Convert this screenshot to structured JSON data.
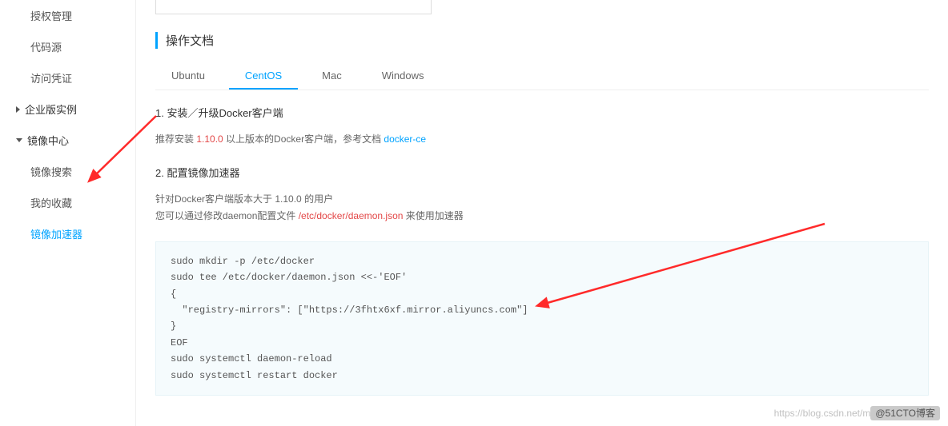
{
  "sidebar": {
    "items": [
      {
        "label": "授权管理"
      },
      {
        "label": "代码源"
      },
      {
        "label": "访问凭证"
      },
      {
        "label": "企业版实例"
      },
      {
        "label": "镜像中心"
      },
      {
        "label": "镜像搜索"
      },
      {
        "label": "我的收藏"
      },
      {
        "label": "镜像加速器"
      }
    ]
  },
  "section_title": "操作文档",
  "tabs": {
    "ubuntu": "Ubuntu",
    "centos": "CentOS",
    "mac": "Mac",
    "windows": "Windows"
  },
  "step1": {
    "heading": "1. 安装／升级Docker客户端",
    "desc_prefix": "推荐安装 ",
    "version": "1.10.0",
    "desc_mid": " 以上版本的Docker客户端，参考文档 ",
    "link": "docker-ce"
  },
  "step2": {
    "heading": "2. 配置镜像加速器",
    "line1_prefix": "针对Docker客户端版本大于 ",
    "line1_version": "1.10.0",
    "line1_suffix": " 的用户",
    "line2_prefix": "您可以通过修改daemon配置文件 ",
    "line2_path": "/etc/docker/daemon.json",
    "line2_suffix": " 来使用加速器"
  },
  "code": "sudo mkdir -p /etc/docker\nsudo tee /etc/docker/daemon.json <<-'EOF'\n{\n  \"registry-mirrors\": [\"https://3fhtx6xf.mirror.aliyuncs.com\"]\n}\nEOF\nsudo systemctl daemon-reload\nsudo systemctl restart docker",
  "watermark": {
    "light": "https://blog.csdn.net/m",
    "dark": "@51CTO博客"
  }
}
